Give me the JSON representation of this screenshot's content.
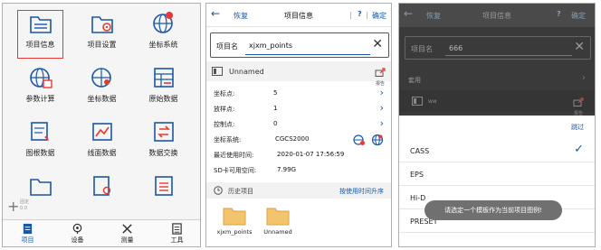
{
  "screen1": {
    "grid": [
      {
        "label": "项目信息",
        "icon": "project-info-icon",
        "selected": true
      },
      {
        "label": "项目设置",
        "icon": "project-settings-icon"
      },
      {
        "label": "坐标系统",
        "icon": "coordinate-system-icon"
      },
      {
        "label": "参数计算",
        "icon": "parameter-calc-icon"
      },
      {
        "label": "坐标数据",
        "icon": "coordinate-data-icon"
      },
      {
        "label": "原始数据",
        "icon": "raw-data-icon"
      },
      {
        "label": "图根数据",
        "icon": "control-data-icon"
      },
      {
        "label": "线面数据",
        "icon": "line-area-data-icon"
      },
      {
        "label": "数据交换",
        "icon": "data-exchange-icon"
      }
    ],
    "fab": {
      "line1": "固定",
      "line2": "0.0"
    },
    "nav": [
      {
        "label": "项目",
        "icon": "project-tab-icon",
        "active": true
      },
      {
        "label": "设备",
        "icon": "device-tab-icon"
      },
      {
        "label": "测量",
        "icon": "measure-tab-icon"
      },
      {
        "label": "工具",
        "icon": "tools-tab-icon"
      }
    ]
  },
  "screen2": {
    "header": {
      "reset": "恢复",
      "title": "项目信息",
      "help": "?",
      "confirm": "确定"
    },
    "name_label": "项目名",
    "name_value": "xjxm_points",
    "template_name": "Unnamed",
    "report_label": "报告",
    "info": [
      {
        "key": "坐标点:",
        "value": "5",
        "chevron": true
      },
      {
        "key": "放样点:",
        "value": "1",
        "chevron": true
      },
      {
        "key": "控制点:",
        "value": "0",
        "chevron": true
      },
      {
        "key": "坐标系统:",
        "value": "CGCS2000",
        "chevron": false
      },
      {
        "key": "最近使用时间:",
        "value": "2020-01-07 17:56:59",
        "chevron": false
      },
      {
        "key": "SD卡可用空间:",
        "value": "7.99G",
        "chevron": false
      }
    ],
    "history_label": "历史项目",
    "sort_label": "按使用时间升序",
    "folders": [
      "xjxm_points",
      "Unnamed"
    ]
  },
  "screen3": {
    "header": {
      "reset": "恢复",
      "title": "项目信息",
      "help": "?",
      "confirm": "确定"
    },
    "name_label": "项目名",
    "name_value": "666",
    "set_label": "套用",
    "template_name": "ww",
    "report_label": "报告",
    "skip_label": "跳过",
    "options": [
      "CASS",
      "EPS",
      "Hi-D",
      "PRESET"
    ],
    "checked_index": 0,
    "toast": "请选定一个模板作为当前项目图例!"
  },
  "colors": {
    "accent": "#1a57a8",
    "selection": "#e53935",
    "dim": "#3a3a3a"
  }
}
